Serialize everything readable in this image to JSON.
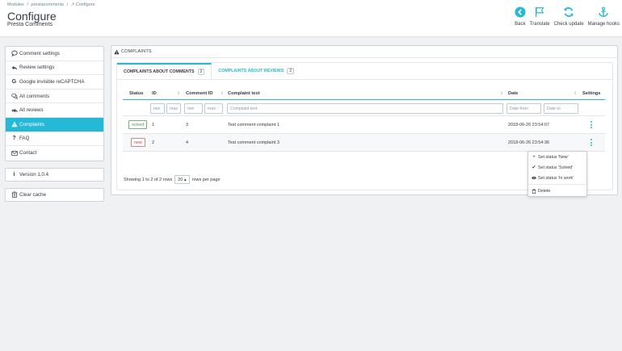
{
  "breadcrumb": [
    "Modules",
    "/",
    "prestacomments",
    "/",
    "↗ Configure"
  ],
  "header": {
    "title": "Configure",
    "subtitle": "Presta Comments"
  },
  "toolbar": [
    {
      "label": "Back",
      "icon": "back-icon"
    },
    {
      "label": "Translate",
      "icon": "flag-icon"
    },
    {
      "label": "Check update",
      "icon": "refresh-icon"
    },
    {
      "label": "Manage hooks",
      "icon": "anchor-icon"
    }
  ],
  "sidebar": {
    "items": [
      {
        "label": "Comment settings",
        "icon": "comment-icon"
      },
      {
        "label": "Review settings",
        "icon": "reply-icon"
      },
      {
        "label": "Google invisible reCAPTCHA",
        "icon": "google-icon"
      },
      {
        "label": "All comments",
        "icon": "comments-icon"
      },
      {
        "label": "All reviews",
        "icon": "reply-all-icon"
      },
      {
        "label": "Complaints",
        "icon": "warning-icon",
        "active": true
      },
      {
        "label": "FAQ",
        "icon": "question-icon"
      },
      {
        "label": "Contact",
        "icon": "envelope-icon"
      }
    ],
    "version": "Version 1.0.4",
    "clear_cache": "Clear cache"
  },
  "panel": {
    "title": "COMPLAINTS",
    "tabs": [
      {
        "label": "COMPLAINTS ABOUT COMMENTS",
        "count": "2",
        "active": true
      },
      {
        "label": "COMPLAINTS ABOUT REVIEWS",
        "count": "2",
        "active": false
      }
    ],
    "columns": {
      "status": "Status",
      "id": "ID",
      "comment_id": "Comment ID",
      "complaint_text": "Complaint text",
      "date": "Date",
      "settings": "Settings"
    },
    "filters": {
      "id_min": "min",
      "id_max": "max",
      "cid_min": "min",
      "cid_max": "max",
      "text": "Complaint text",
      "date_from": "Date from",
      "date_to": "Date to"
    },
    "rows": [
      {
        "status": "solved",
        "id": "1",
        "comment_id": "3",
        "text": "Test comment complaint 1",
        "date": "2018-06-26 23:54:07"
      },
      {
        "status": "new",
        "id": "2",
        "comment_id": "4",
        "text": "Test comment complaint 3",
        "date": "2018-06-26 23:54:36"
      }
    ],
    "pager": {
      "showing": "Showing 1 to 2 of 2 rows",
      "per_page": "20 ▴",
      "rows_label": "rows per page"
    }
  },
  "dropdown": {
    "items": [
      {
        "label": "Set status 'New'",
        "icon": "plus-icon"
      },
      {
        "label": "Set status 'Solved'",
        "icon": "check-icon"
      },
      {
        "label": "Set status 'In work'",
        "icon": "eye-icon"
      }
    ],
    "delete": "Delete"
  },
  "colors": {
    "accent": "#25b9d7",
    "solved": "#70b580",
    "new": "#e08080"
  }
}
